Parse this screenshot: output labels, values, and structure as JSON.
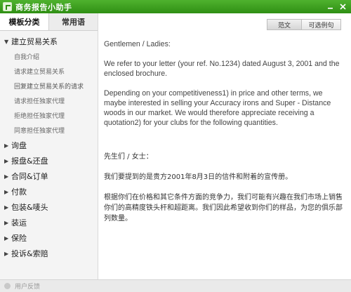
{
  "window": {
    "title": "商务报告小助手"
  },
  "sidebar": {
    "tabs": [
      {
        "label": "模板分类"
      },
      {
        "label": "常用语"
      }
    ],
    "open_category": "建立贸易关系",
    "subitems": [
      "自我介绍",
      "请求建立贸易关系",
      "回复建立贸易关系的请求",
      "请求担任独家代理",
      "拒绝担任独家代理",
      "同意担任独家代理"
    ],
    "categories": [
      "询盘",
      "报盘&还盘",
      "合同&订单",
      "付款",
      "包装&唛头",
      "装运",
      "保险",
      "投诉&索赔"
    ]
  },
  "toolbar": {
    "btn1": "范文",
    "btn2": "可选例句"
  },
  "letter": {
    "greeting": "Gentlemen / Ladies:",
    "para1": "We refer to your letter (your ref. No.1234) dated August 3, 2001 and the enclosed brochure.",
    "para2": "Depending on your competitiveness1) in price and other terms, we maybe interested in selling your Accuracy irons and Super - Distance woods in our market. We would therefore appreciate receiving a quotation2) for your clubs for the following quantities.",
    "cn_greeting": "先生们 / 女士：",
    "cn_para1": "我们要提到的是贵方2001年8月3日的信件和附着的宣传册。",
    "cn_para2": "根据你们在价格和其它条件方面的竞争力，我们可能有兴趣在我们市场上销售你们的高精度铁头杆和超距离。我们因此希望收到你们的样品，为您的俱乐部列数量。"
  },
  "status": {
    "text": "用户反馈"
  }
}
